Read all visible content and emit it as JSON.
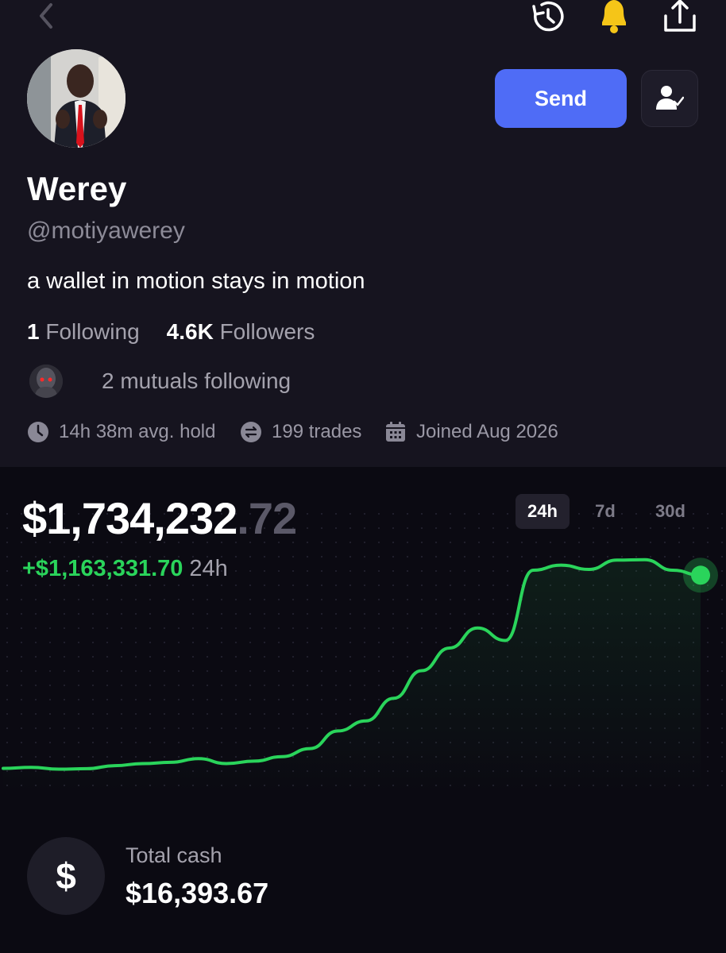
{
  "header": {
    "back_icon": "chevron-left-icon",
    "history_icon": "history-icon",
    "notification_icon": "bell-icon",
    "share_icon": "share-icon",
    "notification_color": "#f5c518"
  },
  "profile": {
    "display_name": "Werey",
    "username": "@motiyawerey",
    "bio": "a wallet in motion stays in motion",
    "following_count": "1",
    "following_label": "Following",
    "followers_count": "4.6K",
    "followers_label": "Followers",
    "mutuals_text": "2 mutuals following",
    "send_label": "Send",
    "follow_icon": "user-check-icon",
    "send_color": "#4f6cf6"
  },
  "meta": {
    "avg_hold": "14h 38m avg. hold",
    "trades": "199 trades",
    "joined": "Joined Aug 2026"
  },
  "portfolio": {
    "balance_whole": "$1,734,232",
    "balance_cents": ".72",
    "change_value": "+$1,163,331.70",
    "change_period": "24h",
    "range_tabs": [
      "24h",
      "7d",
      "30d"
    ],
    "active_range": "24h",
    "accent_color": "#2ad45b"
  },
  "chart_data": {
    "type": "line",
    "title": "",
    "xlabel": "",
    "ylabel": "",
    "grid": "dotted",
    "values": [
      571000,
      575000,
      568000,
      570000,
      582000,
      590000,
      595000,
      610000,
      590000,
      600000,
      618000,
      650000,
      720000,
      760000,
      850000,
      960000,
      1050000,
      1130000,
      1080000,
      1360000,
      1380000,
      1363000,
      1400000,
      1402000,
      1360000,
      1340000
    ],
    "ylim": [
      0,
      1734232.72
    ]
  },
  "cash": {
    "icon": "dollar-icon",
    "label": "Total cash",
    "value": "$16,393.67"
  }
}
